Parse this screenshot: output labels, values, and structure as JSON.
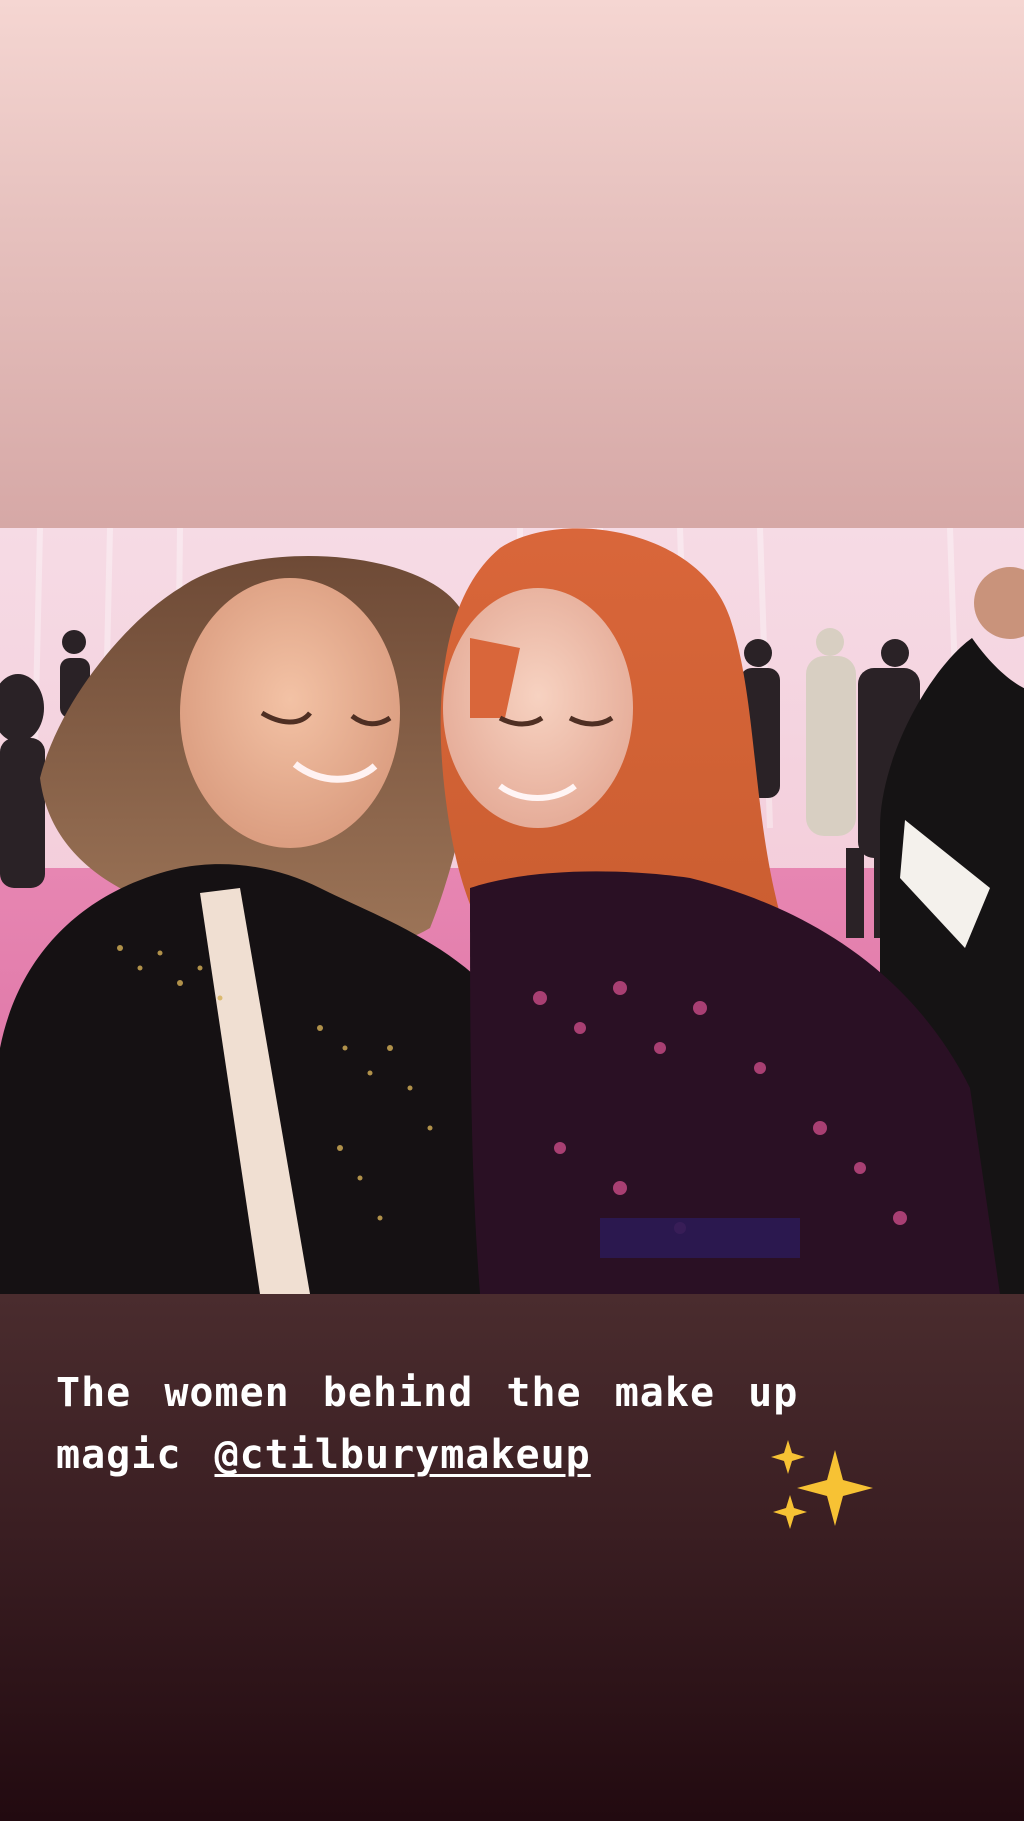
{
  "story": {
    "photo_subject": "two-women-selfie",
    "caption": {
      "line1": "The women behind the make up",
      "line2_prefix": "magic ",
      "mention": "@ctilburymakeup",
      "emoji": "sparkles-icon"
    }
  },
  "colors": {
    "top_gradient": "#e7c2bf",
    "bottom_gradient": "#3a1e22",
    "caption_text": "#ffffff",
    "sparkles": "#f7c234"
  }
}
